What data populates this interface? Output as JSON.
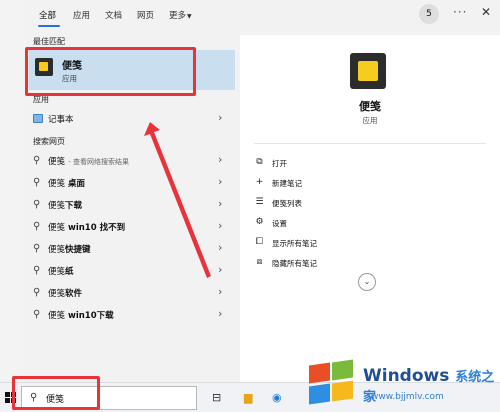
{
  "header": {
    "tabs": [
      {
        "label": "全部",
        "active": true
      },
      {
        "label": "应用"
      },
      {
        "label": "文档"
      },
      {
        "label": "网页"
      },
      {
        "label": "更多"
      }
    ],
    "badge_count": "5",
    "more_icon": "ellipsis-icon",
    "close_icon": "close-icon"
  },
  "best_match": {
    "section_label": "最佳匹配",
    "title": "便笺",
    "subtitle": "应用"
  },
  "apps": {
    "section_label": "应用",
    "items": [
      {
        "label": "记事本",
        "icon": "notepad-icon"
      }
    ]
  },
  "web_search": {
    "section_label": "搜索网页",
    "items": [
      {
        "prefix": "便笺",
        "bold": "",
        "hint": " - 查看网络搜索结果"
      },
      {
        "prefix": "便笺",
        "bold": " 桌面",
        "hint": ""
      },
      {
        "prefix": "便笺",
        "bold": "下载",
        "hint": ""
      },
      {
        "prefix": "便笺",
        "bold": " win10 找不到",
        "hint": ""
      },
      {
        "prefix": "便笺",
        "bold": "快捷键",
        "hint": ""
      },
      {
        "prefix": "便笺",
        "bold": "纸",
        "hint": ""
      },
      {
        "prefix": "便笺",
        "bold": "软件",
        "hint": ""
      },
      {
        "prefix": "便笺",
        "bold": " win10下载",
        "hint": ""
      }
    ]
  },
  "detail": {
    "title": "便笺",
    "subtitle": "应用",
    "actions": [
      {
        "label": "打开",
        "icon": "open-icon"
      },
      {
        "label": "新建笔记",
        "icon": "plus-icon"
      },
      {
        "label": "便笺列表",
        "icon": "list-icon"
      },
      {
        "label": "设置",
        "icon": "gear-icon"
      },
      {
        "label": "显示所有笔记",
        "icon": "show-notes-icon"
      },
      {
        "label": "隐藏所有笔记",
        "icon": "hide-notes-icon"
      }
    ]
  },
  "taskbar": {
    "search_value": "便笺"
  },
  "watermark": {
    "title": "Windows",
    "title_cn": "系统之家",
    "url": "www.bjjmlv.com"
  },
  "colors": {
    "accent": "#2b6ed9",
    "highlight": "#c9dff0",
    "annotation": "#e8333a",
    "sticky_yellow": "#f5cc1f"
  }
}
